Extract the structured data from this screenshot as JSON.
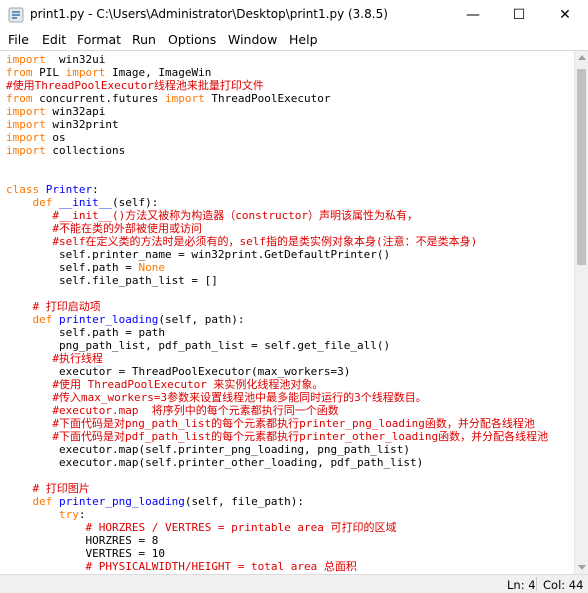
{
  "window": {
    "title": "print1.py - C:\\Users\\Administrator\\Desktop\\print1.py (3.8.5)",
    "minimize": "—",
    "maximize": "☐",
    "close": "✕"
  },
  "menu": [
    "File",
    "Edit",
    "Format",
    "Run",
    "Options",
    "Window",
    "Help"
  ],
  "status": {
    "line": "Ln: 4",
    "col": "Col: 44"
  },
  "code": [
    [
      [
        "kw",
        "import"
      ],
      [
        "",
        "  win32ui"
      ]
    ],
    [
      [
        "kw",
        "from"
      ],
      [
        "",
        " PIL "
      ],
      [
        "kw",
        "import"
      ],
      [
        "",
        " Image, ImageWin"
      ]
    ],
    [
      [
        "cm",
        "#使用ThreadPoolExecutor线程池来批量打印文件"
      ]
    ],
    [
      [
        "kw",
        "from"
      ],
      [
        "",
        " concurrent.futures "
      ],
      [
        "kw",
        "import"
      ],
      [
        "",
        " ThreadPoolExecutor"
      ]
    ],
    [
      [
        "kw",
        "import"
      ],
      [
        "",
        " win32api"
      ]
    ],
    [
      [
        "kw",
        "import"
      ],
      [
        "",
        " win32print"
      ]
    ],
    [
      [
        "kw",
        "import"
      ],
      [
        "",
        " os"
      ]
    ],
    [
      [
        "kw",
        "import"
      ],
      [
        "",
        " collections"
      ]
    ],
    [],
    [],
    [
      [
        "kw",
        "class"
      ],
      [
        "",
        " "
      ],
      [
        "fn",
        "Printer"
      ],
      [
        "",
        ":"
      ]
    ],
    [
      [
        "",
        "    "
      ],
      [
        "kw",
        "def"
      ],
      [
        "",
        " "
      ],
      [
        "fn",
        "__init__"
      ],
      [
        "",
        "(self):"
      ]
    ],
    [
      [
        "",
        "       "
      ],
      [
        "cm",
        "#__init__()方法又被称为构造器（constructor）声明该属性为私有，"
      ]
    ],
    [
      [
        "",
        "       "
      ],
      [
        "cm",
        "#不能在类的外部被使用或访问"
      ]
    ],
    [
      [
        "",
        "       "
      ],
      [
        "cm",
        "#self在定义类的方法时是必须有的，self指的是类实例对象本身(注意：不是类本身)"
      ]
    ],
    [
      [
        "",
        "        self.printer_name = win32print.GetDefaultPrinter()"
      ]
    ],
    [
      [
        "",
        "        self.path = "
      ],
      [
        "kw",
        "None"
      ]
    ],
    [
      [
        "",
        "        self.file_path_list = []"
      ]
    ],
    [],
    [
      [
        "",
        "    "
      ],
      [
        "cm",
        "# 打印启动项"
      ]
    ],
    [
      [
        "",
        "    "
      ],
      [
        "kw",
        "def"
      ],
      [
        "",
        " "
      ],
      [
        "fn",
        "printer_loading"
      ],
      [
        "",
        "(self, path):"
      ]
    ],
    [
      [
        "",
        "        self.path = path"
      ]
    ],
    [
      [
        "",
        "        png_path_list, pdf_path_list = self.get_file_all()"
      ]
    ],
    [
      [
        "",
        "       "
      ],
      [
        "cm",
        "#执行线程"
      ]
    ],
    [
      [
        "",
        "        executor = ThreadPoolExecutor(max_workers=3)"
      ]
    ],
    [
      [
        "",
        "       "
      ],
      [
        "cm",
        "#使用 ThreadPoolExecutor 来实例化线程池对象。"
      ]
    ],
    [
      [
        "",
        "       "
      ],
      [
        "cm",
        "#传入max_workers=3参数来设置线程池中最多能同时运行的3个线程数目。"
      ]
    ],
    [
      [
        "",
        "       "
      ],
      [
        "cm",
        "#executor.map  将序列中的每个元素都执行同一个函数"
      ]
    ],
    [
      [
        "",
        "       "
      ],
      [
        "cm",
        "#下面代码是对png_path_list的每个元素都执行printer_png_loading函数，并分配各线程池"
      ]
    ],
    [
      [
        "",
        "       "
      ],
      [
        "cm",
        "#下面代码是对pdf_path_list的每个元素都执行printer_other_loading函数，并分配各线程池"
      ]
    ],
    [
      [
        "",
        "        executor.map(self.printer_png_loading, png_path_list)"
      ]
    ],
    [
      [
        "",
        "        executor.map(self.printer_other_loading, pdf_path_list)"
      ]
    ],
    [],
    [
      [
        "",
        "    "
      ],
      [
        "cm",
        "# 打印图片"
      ]
    ],
    [
      [
        "",
        "    "
      ],
      [
        "kw",
        "def"
      ],
      [
        "",
        " "
      ],
      [
        "fn",
        "printer_png_loading"
      ],
      [
        "",
        "(self, file_path):"
      ]
    ],
    [
      [
        "",
        "        "
      ],
      [
        "kw",
        "try"
      ],
      [
        "",
        ":"
      ]
    ],
    [
      [
        "",
        "            "
      ],
      [
        "cm",
        "# HORZRES / VERTRES = printable area 可打印的区域"
      ]
    ],
    [
      [
        "",
        "            HORZRES = 8"
      ]
    ],
    [
      [
        "",
        "            VERTRES = 10"
      ]
    ],
    [
      [
        "",
        "            "
      ],
      [
        "cm",
        "# PHYSICALWIDTH/HEIGHT = total area 总面积"
      ]
    ]
  ],
  "colors": {
    "keyword": "#ff7700",
    "comment": "#dd0000",
    "definition": "#0000ff",
    "builtin": "#900090"
  }
}
